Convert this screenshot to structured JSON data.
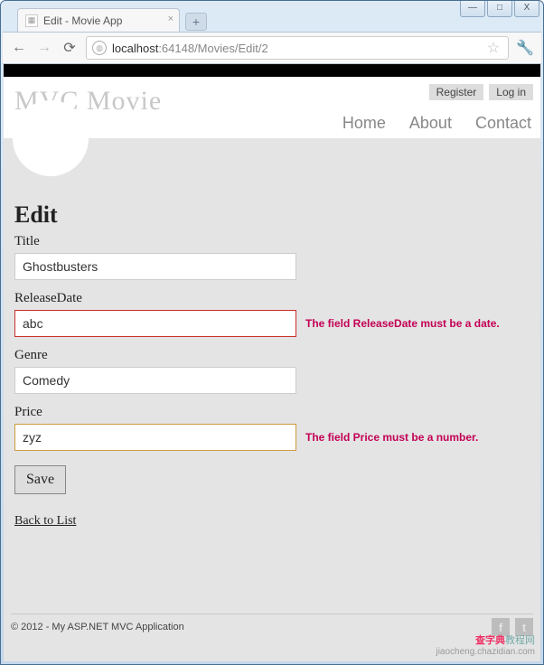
{
  "window": {
    "minimize": "—",
    "maximize": "□",
    "close": "X"
  },
  "browser": {
    "tab_title": "Edit - Movie App",
    "tab_close": "×",
    "new_tab": "+",
    "back": "←",
    "forward": "→",
    "reload": "⟳",
    "url_host": "localhost",
    "url_rest": ":64148/Movies/Edit/2",
    "star": "☆",
    "wrench": "🔧"
  },
  "header": {
    "brand": "MVC Movie",
    "register": "Register",
    "login": "Log in",
    "nav": {
      "home": "Home",
      "about": "About",
      "contact": "Contact"
    }
  },
  "page": {
    "heading": "Edit",
    "fields": {
      "title": {
        "label": "Title",
        "value": "Ghostbusters"
      },
      "releaseDate": {
        "label": "ReleaseDate",
        "value": "abc",
        "error": "The field ReleaseDate must be a date."
      },
      "genre": {
        "label": "Genre",
        "value": "Comedy"
      },
      "price": {
        "label": "Price",
        "value": "zyz",
        "error": "The field Price must be a number."
      }
    },
    "save": "Save",
    "back_link": "Back to List"
  },
  "footer": {
    "text": "© 2012 - My ASP.NET MVC Application",
    "fb": "f",
    "tw": "t"
  },
  "watermark": {
    "line1_a": "查字典",
    "line1_b": "教程网",
    "line2": "jiaocheng.chazidian.com"
  }
}
